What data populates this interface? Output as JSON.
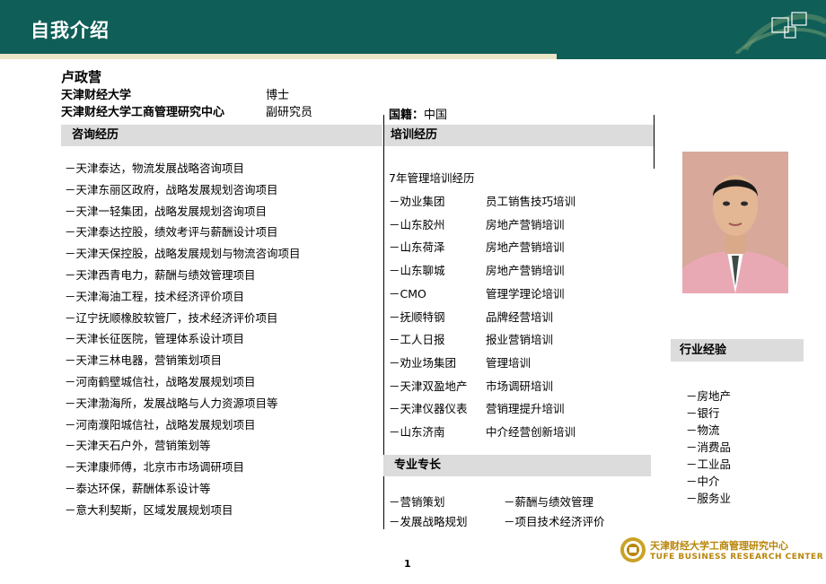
{
  "header": {
    "title": "自我介绍"
  },
  "person": {
    "name": "卢政营",
    "school": "天津财经大学",
    "degree": "博士",
    "center": "天津财经大学工商管理研究中心",
    "position": "副研究员",
    "nationality_label": "国籍：",
    "nationality": "中国"
  },
  "sections": {
    "consulting": "咨询经历",
    "training": "培训经历",
    "expertise": "专业专长",
    "industry": "行业经验"
  },
  "consulting": [
    "－天津泰达，物流发展战略咨询项目",
    "－天津东丽区政府，战略发展规划咨询项目",
    "－天津一轻集团，战略发展规划咨询项目",
    "－天津泰达控股，绩效考评与薪酬设计项目",
    "－天津天保控股，战略发展规划与物流咨询项目",
    "－天津西青电力，薪酬与绩效管理项目",
    "－天津海油工程，技术经济评价项目",
    "－辽宁抚顺橡胶软管厂，技术经济评价项目",
    "－天津长征医院，管理体系设计项目",
    "－天津三林电器，营销策划项目",
    "－河南鹤壁城信社，战略发展规划项目",
    "－天津渤海所，发展战略与人力资源项目等",
    "－河南濮阳城信社，战略发展规划项目",
    "－天津天石户外，营销策划等",
    "－天津康师傅，北京市市场调研项目",
    "－泰达环保，薪酬体系设计等",
    "－意大利契斯，区域发展规划项目"
  ],
  "training_intro": "7年管理培训经历",
  "training": [
    {
      "org": "－劝业集团",
      "topic": "员工销售技巧培训"
    },
    {
      "org": "－山东胶州",
      "topic": "房地产营销培训"
    },
    {
      "org": "－山东荷泽",
      "topic": "房地产营销培训"
    },
    {
      "org": "－山东聊城",
      "topic": "房地产营销培训"
    },
    {
      "org": "－CMO",
      "topic": "管理学理论培训"
    },
    {
      "org": "－抚顺特钢",
      "topic": "品牌经营培训"
    },
    {
      "org": "－工人日报",
      "topic": "报业营销培训"
    },
    {
      "org": "－劝业场集团",
      "topic": "管理培训"
    },
    {
      "org": "－天津双盈地产",
      "topic": "市场调研培训"
    },
    {
      "org": "－天津仪器仪表",
      "topic": "营销理提升培训"
    },
    {
      "org": "－山东济南",
      "topic": "中介经营创新培训"
    }
  ],
  "expertise": [
    [
      "－营销策划",
      "－薪酬与绩效管理"
    ],
    [
      "－发展战略规划",
      "－项目技术经济评价"
    ]
  ],
  "industry": [
    "－房地产",
    "－银行",
    "－物流",
    "－消费品",
    "－工业品",
    "－中介",
    "－服务业"
  ],
  "footer": {
    "cn": "天津财经大学工商管理研究中心",
    "en": "TUFE BUSINESS RESEARCH CENTER",
    "page": "1"
  }
}
